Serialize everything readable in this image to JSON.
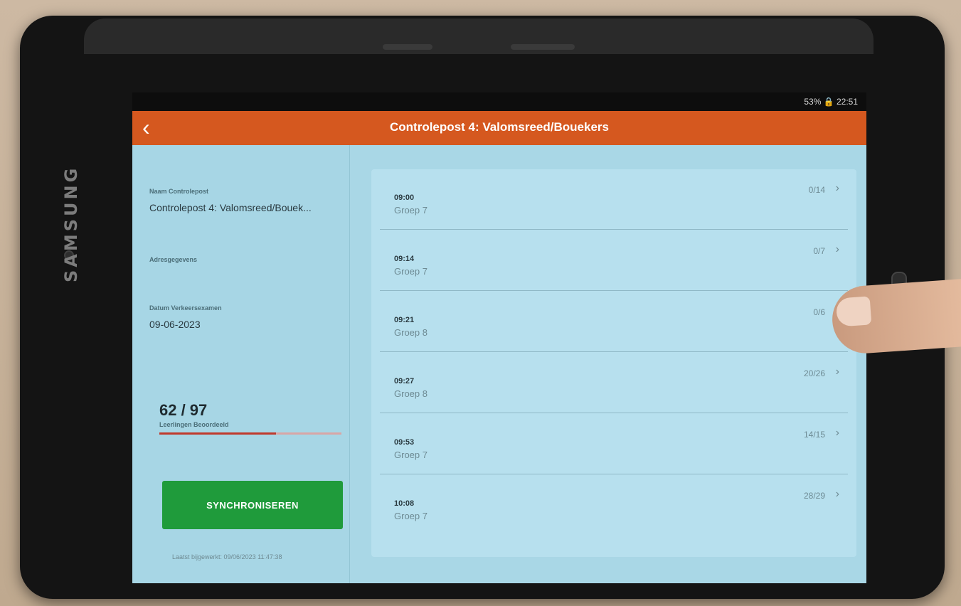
{
  "device": {
    "brand": "SAMSUNG",
    "status": "53% 🔒 22:51"
  },
  "header": {
    "title": "Controlepost 4: Valomsreed/Bouekers",
    "back_icon": "chevron-left-icon"
  },
  "sidebar": {
    "name_label": "Naam Controlepost",
    "name_value": "Controlepost 4: Valomsreed/Bouek...",
    "address_label": "Adresgegevens",
    "date_label": "Datum Verkeersexamen",
    "date_value": "09-06-2023",
    "counter": "62 / 97",
    "counter_label": "Leerlingen Beoordeeld",
    "progress_fraction": 0.64,
    "sync_label": "SYNCHRONISEREN",
    "last_updated": "Laatst bijgewerkt: 09/06/2023 11:47:38"
  },
  "sessions": [
    {
      "time": "09:00",
      "group": "Groep 7",
      "count": "0/14"
    },
    {
      "time": "09:14",
      "group": "Groep 7",
      "count": "0/7"
    },
    {
      "time": "09:21",
      "group": "Groep 8",
      "count": "0/6"
    },
    {
      "time": "09:27",
      "group": "Groep 8",
      "count": "20/26"
    },
    {
      "time": "09:53",
      "group": "Groep 7",
      "count": "14/15"
    },
    {
      "time": "10:08",
      "group": "Groep 7",
      "count": "28/29"
    }
  ],
  "colors": {
    "appbar": "#d5581f",
    "sync_button": "#1f9b3b",
    "progress": "#c0392b"
  }
}
